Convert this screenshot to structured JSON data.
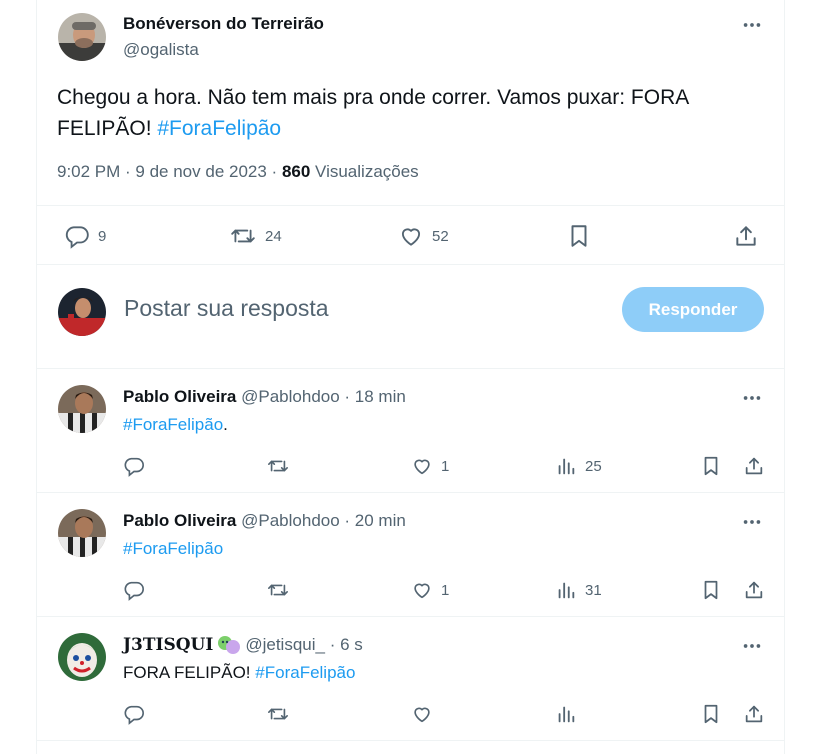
{
  "main_tweet": {
    "author_name": "Bonéverson do Terreirão",
    "author_handle": "@ogalista",
    "text": "Chegou a hora. Não tem mais pra onde correr. Vamos puxar: FORA FELIPÃO!",
    "hashtag": "#ForaFelipão",
    "timestamp": "9:02 PM · 9 de nov de 2023 ·",
    "views_count": "860",
    "views_label": "Visualizações",
    "replies": "9",
    "retweets": "24",
    "likes": "52"
  },
  "composer": {
    "placeholder": "Postar sua resposta",
    "button": "Responder"
  },
  "replies": [
    {
      "name": "Pablo Oliveira",
      "handle": "@Pablohdoo · 18 min",
      "text_prefix": "",
      "hashtag": "#ForaFelipão",
      "text_suffix": ".",
      "replies": "",
      "retweets": "",
      "likes": "1",
      "views": "25"
    },
    {
      "name": "Pablo Oliveira",
      "handle": "@Pablohdoo · 20 min",
      "text_prefix": "",
      "hashtag": "#ForaFelipão",
      "text_suffix": "",
      "replies": "",
      "retweets": "",
      "likes": "1",
      "views": "31"
    },
    {
      "name": "J3TISQUI",
      "handle": "@jetisqui_ · 6 s",
      "text_prefix": "FORA FELIPÃO!",
      "hashtag": "#ForaFelipão",
      "text_suffix": "",
      "replies": "",
      "retweets": "",
      "likes": "",
      "views": ""
    }
  ],
  "colors": {
    "accent": "#1d9bf0",
    "button_disabled": "#8ecdf8",
    "secondary_text": "#536471",
    "border": "#eff3f4"
  },
  "icons": [
    "reply-icon",
    "retweet-icon",
    "like-icon",
    "views-icon",
    "bookmark-icon",
    "share-icon",
    "more-icon",
    "masks-emoji"
  ]
}
